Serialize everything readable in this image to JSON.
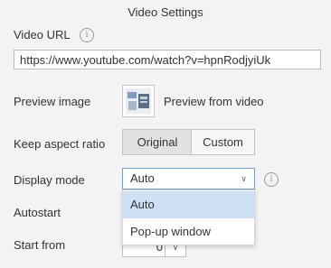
{
  "panel": {
    "title": "Video Settings"
  },
  "video_url": {
    "label": "Video URL",
    "info_icon": "info-icon",
    "value": "https://www.youtube.com/watch?v=hpnRodjyiUk"
  },
  "preview_image": {
    "label": "Preview image",
    "thumbnail_icon": "video-thumbnail",
    "caption": "Preview from video"
  },
  "aspect_ratio": {
    "label": "Keep aspect ratio",
    "options": [
      "Original",
      "Custom"
    ],
    "selected": "Original"
  },
  "display_mode": {
    "label": "Display mode",
    "value": "Auto",
    "info_icon": "info-icon",
    "dropdown_options": [
      "Auto",
      "Pop-up window"
    ],
    "highlighted": "Auto"
  },
  "autostart": {
    "label": "Autostart"
  },
  "start_from": {
    "label": "Start from",
    "value": "0"
  },
  "colors": {
    "background": "#f3f3f3",
    "select_border": "#6f9fd2",
    "option_highlight": "#cde0f5",
    "segment_selected": "#e2e2e2"
  }
}
